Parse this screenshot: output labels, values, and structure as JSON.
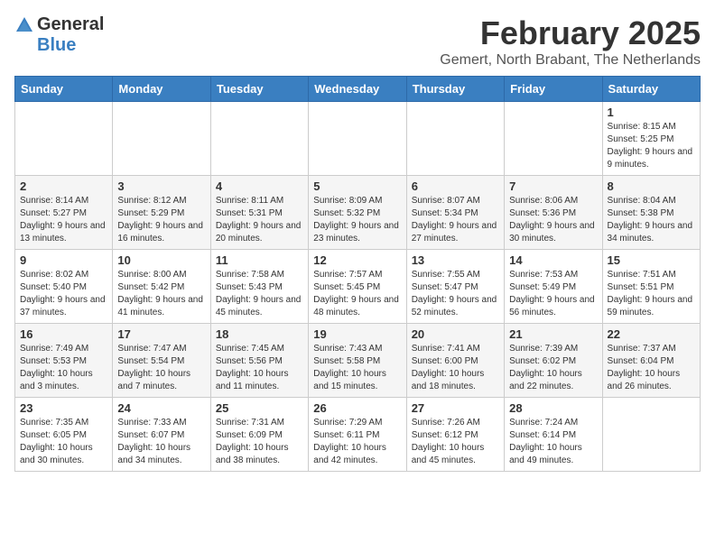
{
  "header": {
    "logo_general": "General",
    "logo_blue": "Blue",
    "month_year": "February 2025",
    "location": "Gemert, North Brabant, The Netherlands"
  },
  "weekdays": [
    "Sunday",
    "Monday",
    "Tuesday",
    "Wednesday",
    "Thursday",
    "Friday",
    "Saturday"
  ],
  "weeks": [
    [
      {
        "day": "",
        "info": ""
      },
      {
        "day": "",
        "info": ""
      },
      {
        "day": "",
        "info": ""
      },
      {
        "day": "",
        "info": ""
      },
      {
        "day": "",
        "info": ""
      },
      {
        "day": "",
        "info": ""
      },
      {
        "day": "1",
        "info": "Sunrise: 8:15 AM\nSunset: 5:25 PM\nDaylight: 9 hours and 9 minutes."
      }
    ],
    [
      {
        "day": "2",
        "info": "Sunrise: 8:14 AM\nSunset: 5:27 PM\nDaylight: 9 hours and 13 minutes."
      },
      {
        "day": "3",
        "info": "Sunrise: 8:12 AM\nSunset: 5:29 PM\nDaylight: 9 hours and 16 minutes."
      },
      {
        "day": "4",
        "info": "Sunrise: 8:11 AM\nSunset: 5:31 PM\nDaylight: 9 hours and 20 minutes."
      },
      {
        "day": "5",
        "info": "Sunrise: 8:09 AM\nSunset: 5:32 PM\nDaylight: 9 hours and 23 minutes."
      },
      {
        "day": "6",
        "info": "Sunrise: 8:07 AM\nSunset: 5:34 PM\nDaylight: 9 hours and 27 minutes."
      },
      {
        "day": "7",
        "info": "Sunrise: 8:06 AM\nSunset: 5:36 PM\nDaylight: 9 hours and 30 minutes."
      },
      {
        "day": "8",
        "info": "Sunrise: 8:04 AM\nSunset: 5:38 PM\nDaylight: 9 hours and 34 minutes."
      }
    ],
    [
      {
        "day": "9",
        "info": "Sunrise: 8:02 AM\nSunset: 5:40 PM\nDaylight: 9 hours and 37 minutes."
      },
      {
        "day": "10",
        "info": "Sunrise: 8:00 AM\nSunset: 5:42 PM\nDaylight: 9 hours and 41 minutes."
      },
      {
        "day": "11",
        "info": "Sunrise: 7:58 AM\nSunset: 5:43 PM\nDaylight: 9 hours and 45 minutes."
      },
      {
        "day": "12",
        "info": "Sunrise: 7:57 AM\nSunset: 5:45 PM\nDaylight: 9 hours and 48 minutes."
      },
      {
        "day": "13",
        "info": "Sunrise: 7:55 AM\nSunset: 5:47 PM\nDaylight: 9 hours and 52 minutes."
      },
      {
        "day": "14",
        "info": "Sunrise: 7:53 AM\nSunset: 5:49 PM\nDaylight: 9 hours and 56 minutes."
      },
      {
        "day": "15",
        "info": "Sunrise: 7:51 AM\nSunset: 5:51 PM\nDaylight: 9 hours and 59 minutes."
      }
    ],
    [
      {
        "day": "16",
        "info": "Sunrise: 7:49 AM\nSunset: 5:53 PM\nDaylight: 10 hours and 3 minutes."
      },
      {
        "day": "17",
        "info": "Sunrise: 7:47 AM\nSunset: 5:54 PM\nDaylight: 10 hours and 7 minutes."
      },
      {
        "day": "18",
        "info": "Sunrise: 7:45 AM\nSunset: 5:56 PM\nDaylight: 10 hours and 11 minutes."
      },
      {
        "day": "19",
        "info": "Sunrise: 7:43 AM\nSunset: 5:58 PM\nDaylight: 10 hours and 15 minutes."
      },
      {
        "day": "20",
        "info": "Sunrise: 7:41 AM\nSunset: 6:00 PM\nDaylight: 10 hours and 18 minutes."
      },
      {
        "day": "21",
        "info": "Sunrise: 7:39 AM\nSunset: 6:02 PM\nDaylight: 10 hours and 22 minutes."
      },
      {
        "day": "22",
        "info": "Sunrise: 7:37 AM\nSunset: 6:04 PM\nDaylight: 10 hours and 26 minutes."
      }
    ],
    [
      {
        "day": "23",
        "info": "Sunrise: 7:35 AM\nSunset: 6:05 PM\nDaylight: 10 hours and 30 minutes."
      },
      {
        "day": "24",
        "info": "Sunrise: 7:33 AM\nSunset: 6:07 PM\nDaylight: 10 hours and 34 minutes."
      },
      {
        "day": "25",
        "info": "Sunrise: 7:31 AM\nSunset: 6:09 PM\nDaylight: 10 hours and 38 minutes."
      },
      {
        "day": "26",
        "info": "Sunrise: 7:29 AM\nSunset: 6:11 PM\nDaylight: 10 hours and 42 minutes."
      },
      {
        "day": "27",
        "info": "Sunrise: 7:26 AM\nSunset: 6:12 PM\nDaylight: 10 hours and 45 minutes."
      },
      {
        "day": "28",
        "info": "Sunrise: 7:24 AM\nSunset: 6:14 PM\nDaylight: 10 hours and 49 minutes."
      },
      {
        "day": "",
        "info": ""
      }
    ]
  ]
}
